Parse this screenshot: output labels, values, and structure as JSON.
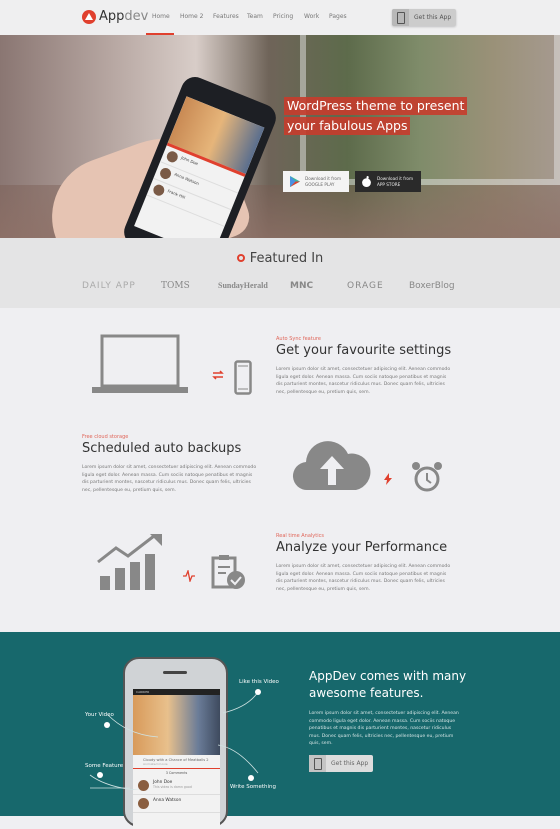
{
  "header": {
    "logo": {
      "brand_main": "App",
      "brand_accent": "dev"
    },
    "nav": [
      "Home",
      "Home 2",
      "Features",
      "Team",
      "Pricing",
      "Work",
      "Pages"
    ],
    "active_nav": "Home",
    "cta_label": "Get this App"
  },
  "hero": {
    "headline_line1": "WordPress theme to present",
    "headline_line2": "your fabulous Apps",
    "google_play": {
      "small": "Download it from",
      "big": "GOOGLE PLAY"
    },
    "app_store": {
      "small": "Download it from",
      "big": "APP STORE"
    },
    "phone_rows": [
      "John Doe",
      "Anna Watson",
      "Frank Hill"
    ]
  },
  "featured": {
    "title": "Featured In",
    "brands": [
      "DAILY APP",
      "TOMS",
      "SundayHerald",
      "MNC",
      "ORAGE",
      "BoxerBlog"
    ]
  },
  "features": [
    {
      "tag": "Auto Sync feature",
      "title": "Get your favourite settings",
      "body": "Lorem ipsum dolor sit amet, consectetuer adipiscing elit. Aenean commodo ligula eget dolor. Aenean massa. Cum sociis natoque penatibus et magnis dis parturient montes, nascetur ridiculus mus. Donec quam felis, ultricies nec, pellentesque eu, pretium quis, sem."
    },
    {
      "tag": "Free cloud storage",
      "title": "Scheduled auto backups",
      "body": "Lorem ipsum dolor sit amet, consectetuer adipiscing elit. Aenean commodo ligula eget dolor. Aenean massa. Cum sociis natoque penatibus et magnis dis parturient montes, nascetur ridiculus mus. Donec quam felis, ultricies nec, pellentesque eu, pretium quis, sem."
    },
    {
      "tag": "Real time Analytics",
      "title": "Analyze your Performance",
      "body": "Lorem ipsum dolor sit amet, consectetuer adipiscing elit. Aenean commodo ligula eget dolor. Aenean massa. Cum sociis natoque penatibus et magnis dis parturient montes, nascetur ridiculus mus. Donec quam felis, ultricies nec, pellentesque eu, pretium quis, sem."
    }
  ],
  "showcase": {
    "title": "AppDev comes with many awesome features.",
    "body": "Lorem ipsum dolor sit amet, consectetuer adipiscing elit. Aenean commodo ligula eget dolor. Aenean massa. Cum sociis natoque penatibus et magnis dis parturient montes, nascetur ridiculus mus. Donec quam felis, ultricies nec, pellentesque eu, pretium quis, sem.",
    "cta_label": "Get this App",
    "callouts": {
      "your_video": "Your Video",
      "like_video": "Like this Video",
      "some_feature": "Some Feature",
      "write_something": "Write Something"
    },
    "phone": {
      "carrier": "CARRIER",
      "caption": "Cloudy with a Chance of Meatballs 2",
      "caption_sub": "Animated movie",
      "comments": "3 Comments",
      "rows": [
        {
          "name": "John Doe",
          "text": "This video is damn good"
        },
        {
          "name": "Anna Watson",
          "text": ""
        }
      ]
    }
  },
  "colors": {
    "accent": "#e0402e",
    "teal": "#17686c",
    "icon_gray": "#888888"
  }
}
